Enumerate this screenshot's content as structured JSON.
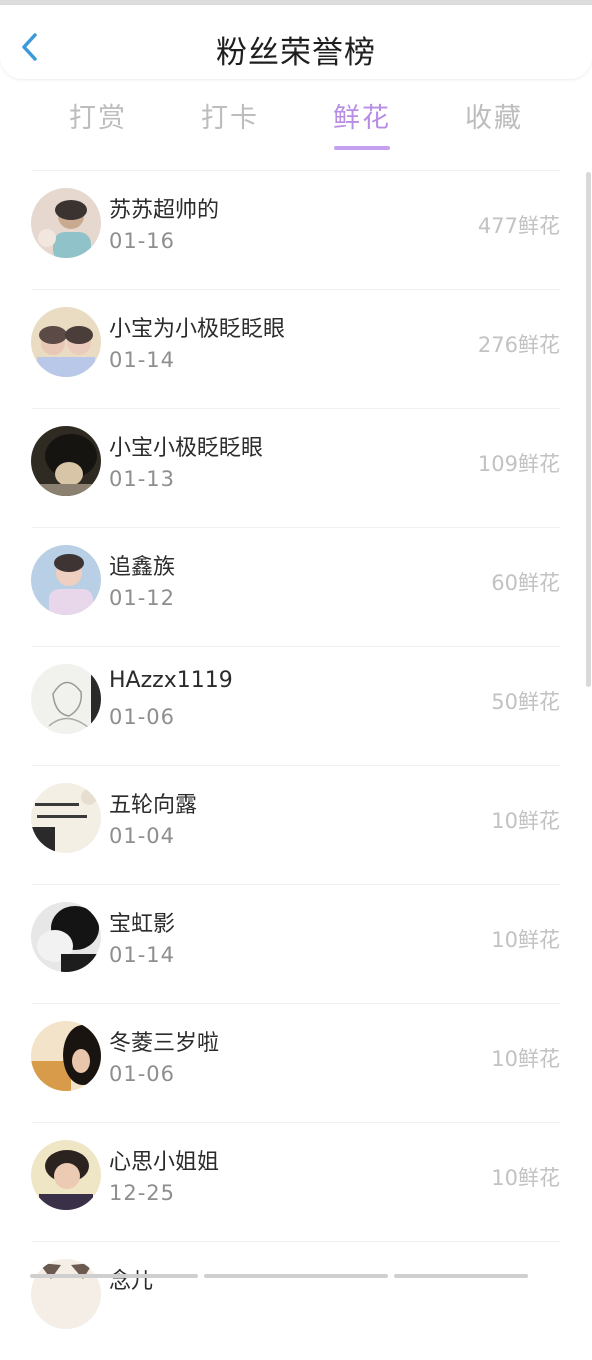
{
  "header": {
    "title": "粉丝荣誉榜"
  },
  "tabs": [
    {
      "label": "打赏",
      "active": false
    },
    {
      "label": "打卡",
      "active": false
    },
    {
      "label": "鲜花",
      "active": true
    },
    {
      "label": "收藏",
      "active": false
    }
  ],
  "colors": {
    "accent": "#b98de4",
    "back_icon": "#3b9ad9",
    "muted": "#c2c2c2"
  },
  "icons": {
    "back": "chevron-left-icon"
  },
  "fans": [
    {
      "name": "苏苏超帅的",
      "date": "01-16",
      "amount": "477鲜花"
    },
    {
      "name": "小宝为小极眨眨眼",
      "date": "01-14",
      "amount": "276鲜花"
    },
    {
      "name": "小宝小极眨眨眼",
      "date": "01-13",
      "amount": "109鲜花"
    },
    {
      "name": "追鑫族",
      "date": "01-12",
      "amount": "60鲜花"
    },
    {
      "name": "HAzzx1119",
      "date": "01-06",
      "amount": "50鲜花"
    },
    {
      "name": "五轮向露",
      "date": "01-04",
      "amount": "10鲜花"
    },
    {
      "name": "宝虹影",
      "date": "01-14",
      "amount": "10鲜花"
    },
    {
      "name": "冬菱三岁啦",
      "date": "01-06",
      "amount": "10鲜花"
    },
    {
      "name": "心思小姐姐",
      "date": "12-25",
      "amount": "10鲜花"
    },
    {
      "name": "念儿",
      "date": "",
      "amount": ""
    }
  ]
}
